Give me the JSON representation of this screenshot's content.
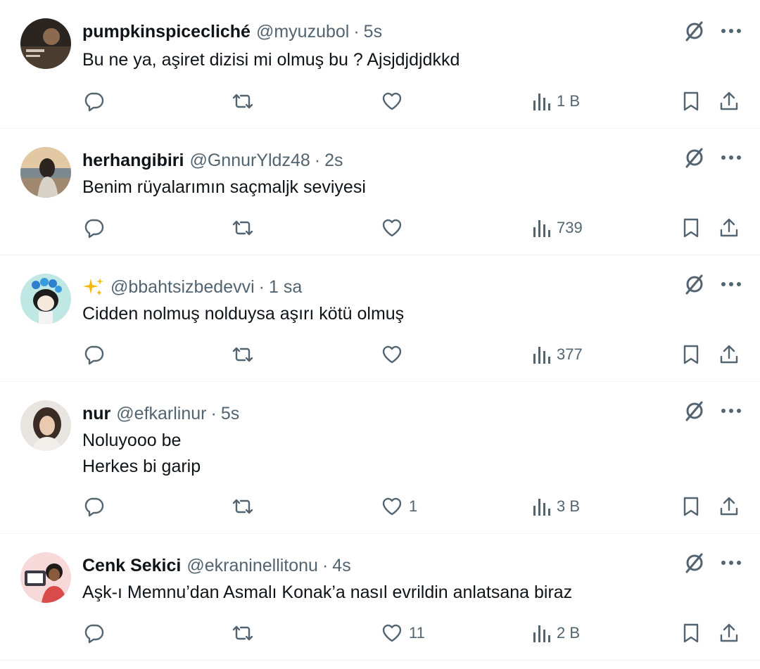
{
  "tweets": [
    {
      "name": "pumpkinspicecliché",
      "handle": "@myuzubol",
      "separator": "·",
      "time": "5s",
      "lines": [
        "Bu ne ya, aşiret dizisi mi olmuş bu ? Ajsjdjdjdkkd"
      ],
      "likes": "",
      "views": "1 B",
      "avatar": "avatar-dark-photo"
    },
    {
      "name": "herhangibiri",
      "handle": "@GnnurYldz48",
      "separator": "·",
      "time": "2s",
      "lines": [
        "Benim rüyalarımın saçmaljk seviyesi"
      ],
      "likes": "",
      "views": "739",
      "avatar": "avatar-beach-photo"
    },
    {
      "name": "",
      "name_icon": "sparkles-emoji",
      "handle": "@bbahtsizbedevvi",
      "separator": "·",
      "time": "1 sa",
      "lines": [
        "Cidden nolmuş nolduysa aşırı kötü olmuş"
      ],
      "likes": "",
      "views": "377",
      "avatar": "avatar-cartoon-flowers"
    },
    {
      "name": "nur",
      "handle": "@efkarlinur",
      "separator": "·",
      "time": "5s",
      "lines": [
        "Noluyooo be",
        "Herkes bi garip"
      ],
      "likes": "1",
      "views": "3 B",
      "avatar": "avatar-portrait-photo"
    },
    {
      "name": "Cenk Sekici",
      "handle": "@ekraninellitonu",
      "separator": "·",
      "time": "4s",
      "lines": [
        "Aşk-ı Memnu’dan Asmalı Konak’a nasıl evrildin anlatsana biraz"
      ],
      "likes": "11",
      "views": "2 B",
      "avatar": "avatar-illustration-tv"
    }
  ],
  "icons": {
    "reply": "reply-icon",
    "retweet": "retweet-icon",
    "like": "heart-icon",
    "views": "views-bar-chart-icon",
    "bookmark": "bookmark-icon",
    "share": "share-icon",
    "grok": "grok-slash-icon",
    "more": "more-dots-icon"
  },
  "colors": {
    "text": "#0f1419",
    "secondary": "#536471",
    "divider": "#eff3f4"
  }
}
